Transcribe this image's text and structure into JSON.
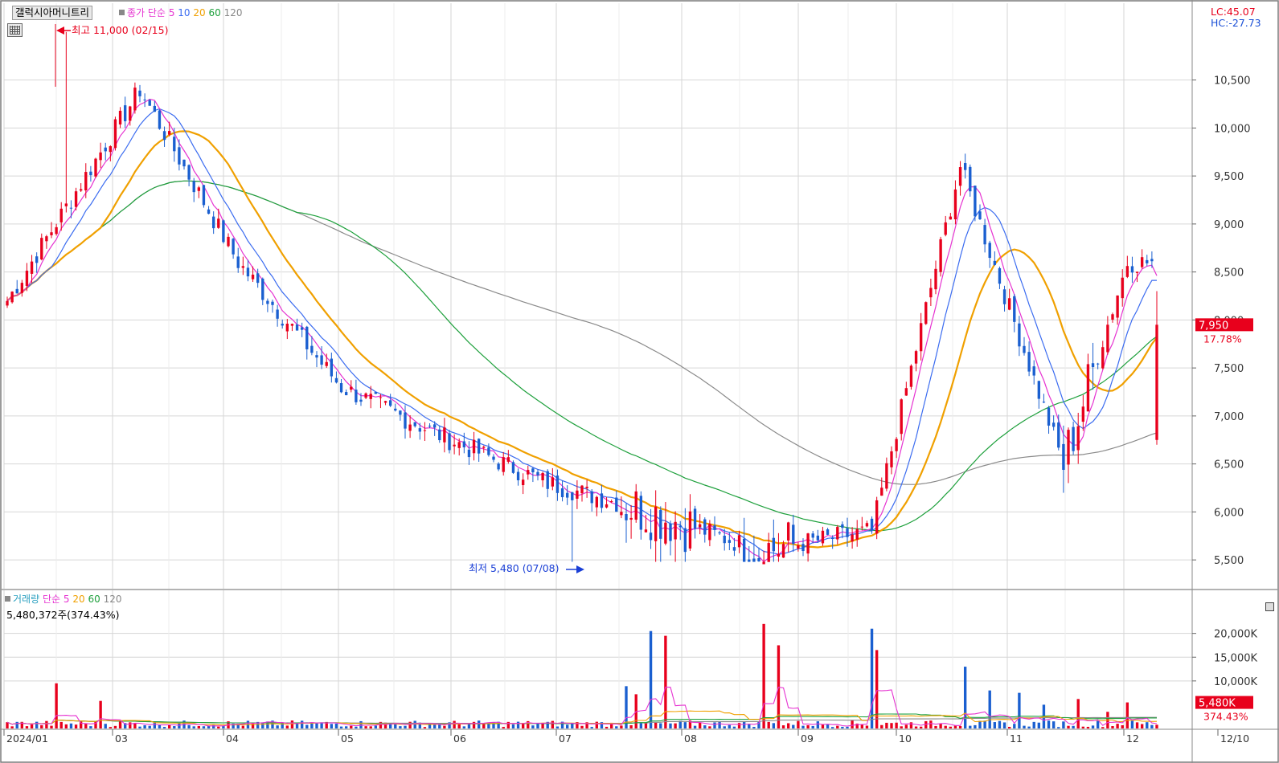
{
  "header": {
    "stock_name": "갤럭시아머니트리",
    "legend_label": "종가 단순",
    "ma_periods": [
      "5",
      "10",
      "20",
      "60",
      "120"
    ],
    "lc_text": "LC:45.07",
    "hc_text": "HC:-27.73"
  },
  "colors": {
    "up": "#e8001c",
    "down": "#1a5fd0",
    "ma5": "#e633d1",
    "ma10": "#3b6cf0",
    "ma20": "#f0a000",
    "ma60": "#1ea03c",
    "ma120": "#8a8a8a",
    "grid": "#d6d6d6",
    "label_high": "#e8001c",
    "label_low": "#1a3fd6"
  },
  "annotations": {
    "high_label": "최고 11,000 (02/15)",
    "low_label": "최저 5,480 (07/08)",
    "current_price": "7,950",
    "current_change": "17.78%"
  },
  "volume_panel": {
    "legend_title": "거래량",
    "legend_label": "단순",
    "ma_periods": [
      "5",
      "20",
      "60",
      "120"
    ],
    "info_text": "5,480,372주(374.43%)",
    "current_volume": "5,480K",
    "current_change": "374.43%"
  },
  "chart_data": [
    {
      "type": "candlestick",
      "title": "",
      "x_labels": [
        "2024/01",
        "03",
        "04",
        "05",
        "06",
        "07",
        "08",
        "09",
        "10",
        "11",
        "12",
        "12/10"
      ],
      "price_ticks": [
        "10,500",
        "10,000",
        "9,500",
        "9,000",
        "8,500",
        "8,000",
        "7,500",
        "7,000",
        "6,500",
        "6,000",
        "5,500"
      ],
      "ylim": [
        5200,
        11300
      ],
      "anchors": {
        "day_index": [
          0,
          27,
          47,
          68,
          88,
          110,
          131,
          153,
          176,
          194,
          215,
          228
        ],
        "price": [
          8200,
          10400,
          8600,
          7300,
          6800,
          6300,
          6000,
          5600,
          5800,
          9600,
          6500,
          8600,
          7100,
          8800,
          8000,
          8400,
          7800,
          10500,
          7600,
          8500,
          8300,
          7000,
          7950
        ]
      },
      "candles_generated_from_anchors": true,
      "ma_series": [
        "5",
        "10",
        "20",
        "60",
        "120"
      ]
    },
    {
      "type": "bar",
      "title": "",
      "y_ticks": [
        "20,000K",
        "15,000K",
        "10,000K"
      ],
      "ylim": [
        0,
        24000
      ],
      "unit": "K shares",
      "spikes": {
        "day_index": [
          10,
          19,
          126,
          128,
          131,
          134,
          154,
          157,
          176,
          177,
          195,
          200,
          206,
          211,
          218,
          224,
          228
        ],
        "volume_k": [
          9500,
          5800,
          8900,
          7200,
          20500,
          19500,
          22000,
          17500,
          21000,
          16500,
          13000,
          8000,
          7500,
          5000,
          6200,
          3500,
          5480
        ]
      }
    }
  ]
}
